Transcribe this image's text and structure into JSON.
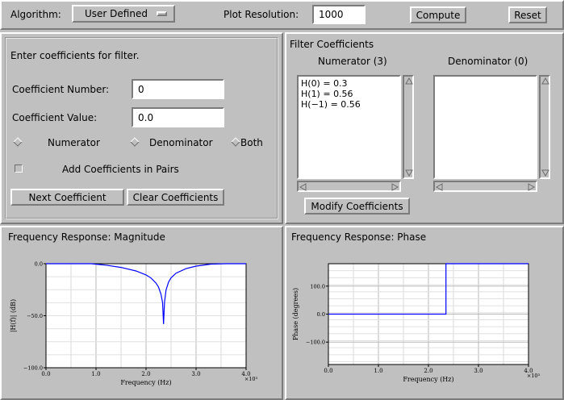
{
  "toolbar": {
    "algorithm_label": "Algorithm:",
    "algorithm_value": "User Defined",
    "resolution_label": "Plot Resolution:",
    "resolution_value": "1000",
    "compute_label": "Compute",
    "reset_label": "Reset"
  },
  "entry": {
    "heading": "Enter coefficients for filter.",
    "coef_number_label": "Coefficient Number:",
    "coef_number_value": "0",
    "coef_value_label": "Coefficient Value:",
    "coef_value_value": "0.0",
    "radio_numerator": "Numerator",
    "radio_denominator": "Denominator",
    "radio_both": "Both",
    "pairs_label": "Add Coefficients in Pairs",
    "next_label": "Next Coefficient",
    "clear_label": "Clear Coefficients"
  },
  "coeffs": {
    "title": "Filter Coefficients",
    "numerator_title": "Numerator (3)",
    "denominator_title": "Denominator (0)",
    "numerator_lines": [
      "H(0) = 0.3",
      "H(1) = 0.56",
      "H(−1) = 0.56"
    ],
    "modify_label": "Modify Coefficients"
  },
  "magnitude": {
    "title": "Frequency Response: Magnitude"
  },
  "phase": {
    "title": "Frequency Response: Phase"
  },
  "chart_data": [
    {
      "type": "line",
      "ylabel": "|H(f)| (dB)",
      "xlabel": "Frequency (Hz)",
      "x_multiplier_label": "×10³",
      "xlim": [
        0,
        4.0
      ],
      "ylim": [
        -100,
        0
      ],
      "xticks": [
        0.0,
        1.0,
        2.0,
        3.0,
        4.0
      ],
      "xtick_labels": [
        "0.0",
        "1.0",
        "2.0",
        "3.0",
        "4.0"
      ],
      "yticks": [
        0,
        -50,
        -100
      ],
      "ytick_labels": [
        "0.0",
        "−50.0",
        "−100.0"
      ],
      "grid": true,
      "line_color": "#0000ff",
      "series": [
        {
          "x": [
            0.0,
            0.3,
            0.6,
            0.9,
            1.2,
            1.5,
            1.8,
            2.0,
            2.1,
            2.2,
            2.25,
            2.3,
            2.33,
            2.35,
            2.37,
            2.4,
            2.45,
            2.5,
            2.6,
            2.8,
            3.0,
            3.3,
            3.6,
            3.9,
            4.0
          ],
          "y": [
            2.5,
            2.4,
            1.6,
            0.3,
            -1.4,
            -3.6,
            -7.0,
            -10.8,
            -13.8,
            -18.7,
            -22.5,
            -29.6,
            -37.5,
            -58.0,
            -37.0,
            -25.3,
            -17.7,
            -13.6,
            -9.1,
            -4.7,
            -2.3,
            -0.4,
            0.6,
            0.9,
            0.9
          ]
        }
      ]
    },
    {
      "type": "line",
      "ylabel": "Phase (degrees)",
      "xlabel": "Frequency (Hz)",
      "x_multiplier_label": "×10³",
      "xlim": [
        0,
        4.0
      ],
      "ylim": [
        -180,
        180
      ],
      "xticks": [
        0.0,
        1.0,
        2.0,
        3.0,
        4.0
      ],
      "xtick_labels": [
        "0.0",
        "1.0",
        "2.0",
        "3.0",
        "4.0"
      ],
      "yticks": [
        100,
        0,
        -100
      ],
      "ytick_labels": [
        "100.0",
        "0.0",
        "−100.0"
      ],
      "grid": true,
      "line_color": "#0000ff",
      "series": [
        {
          "x": [
            0.0,
            2.35,
            2.35,
            4.0
          ],
          "y": [
            0,
            0,
            180,
            180
          ]
        }
      ]
    }
  ]
}
